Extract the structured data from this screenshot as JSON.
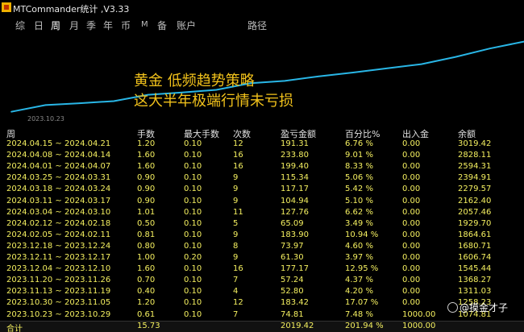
{
  "window": {
    "title": "MTCommander统计 ,V3.33",
    "icon": "app-icon"
  },
  "tabs": [
    {
      "label": "综",
      "active": false
    },
    {
      "label": "日",
      "active": false
    },
    {
      "label": "周",
      "active": true
    },
    {
      "label": "月",
      "active": false
    },
    {
      "label": "季",
      "active": false
    },
    {
      "label": "年",
      "active": false
    },
    {
      "label": "币",
      "active": false
    },
    {
      "label": "M",
      "active": false
    },
    {
      "label": "备",
      "active": false
    },
    {
      "label": "账户",
      "active": false
    },
    {
      "label": "路径",
      "active": false
    }
  ],
  "chart": {
    "line_color": "#29b6e6",
    "overlay_line1": "黄金  低频趋势策略",
    "overlay_line2": "这大半年极端行情未亏损",
    "date_label": "2023.10.23"
  },
  "chart_data": {
    "type": "line",
    "x": [
      "2023.10.23",
      "2023.10.30",
      "2023.11.13",
      "2023.11.20",
      "2023.12.04",
      "2023.12.11",
      "2023.12.18",
      "2024.02.05",
      "2024.02.12",
      "2024.03.04",
      "2024.03.11",
      "2024.03.18",
      "2024.03.25",
      "2024.04.01",
      "2024.04.08",
      "2024.04.15"
    ],
    "series": [
      {
        "values": [
          1074.81,
          1258.23,
          1311.03,
          1368.27,
          1545.44,
          1606.74,
          1680.71,
          1864.61,
          1929.7,
          2057.46,
          2162.4,
          2279.57,
          2394.91,
          2594.31,
          2828.11,
          3019.42
        ]
      }
    ],
    "title": "",
    "xlabel": "",
    "ylabel": "",
    "ylim": [
      1000,
      3100
    ],
    "grid": false
  },
  "table": {
    "headers": [
      "周",
      "手数",
      "最大手数",
      "次数",
      "盈亏金额",
      "百分比%",
      "出入金",
      "余额"
    ],
    "rows": [
      [
        "2024.04.15 ~ 2024.04.21",
        "1.20",
        "0.10",
        "12",
        "191.31",
        "6.76 %",
        "0.00",
        "3019.42"
      ],
      [
        "2024.04.08 ~ 2024.04.14",
        "1.60",
        "0.10",
        "16",
        "233.80",
        "9.01 %",
        "0.00",
        "2828.11"
      ],
      [
        "2024.04.01 ~ 2024.04.07",
        "1.60",
        "0.10",
        "16",
        "199.40",
        "8.33 %",
        "0.00",
        "2594.31"
      ],
      [
        "2024.03.25 ~ 2024.03.31",
        "0.90",
        "0.10",
        "9",
        "115.34",
        "5.06 %",
        "0.00",
        "2394.91"
      ],
      [
        "2024.03.18 ~ 2024.03.24",
        "0.90",
        "0.10",
        "9",
        "117.17",
        "5.42 %",
        "0.00",
        "2279.57"
      ],
      [
        "2024.03.11 ~ 2024.03.17",
        "0.90",
        "0.10",
        "9",
        "104.94",
        "5.10 %",
        "0.00",
        "2162.40"
      ],
      [
        "2024.03.04 ~ 2024.03.10",
        "1.01",
        "0.10",
        "11",
        "127.76",
        "6.62 %",
        "0.00",
        "2057.46"
      ],
      [
        "2024.02.12 ~ 2024.02.18",
        "0.50",
        "0.10",
        "5",
        "65.09",
        "3.49 %",
        "0.00",
        "1929.70"
      ],
      [
        "2024.02.05 ~ 2024.02.11",
        "0.81",
        "0.10",
        "9",
        "183.90",
        "10.94 %",
        "0.00",
        "1864.61"
      ],
      [
        "2023.12.18 ~ 2023.12.24",
        "0.80",
        "0.10",
        "8",
        "73.97",
        "4.60 %",
        "0.00",
        "1680.71"
      ],
      [
        "2023.12.11 ~ 2023.12.17",
        "1.00",
        "0.20",
        "9",
        "61.30",
        "3.97 %",
        "0.00",
        "1606.74"
      ],
      [
        "2023.12.04 ~ 2023.12.10",
        "1.60",
        "0.10",
        "16",
        "177.17",
        "12.95 %",
        "0.00",
        "1545.44"
      ],
      [
        "2023.11.20 ~ 2023.11.26",
        "0.70",
        "0.10",
        "7",
        "57.24",
        "4.37 %",
        "0.00",
        "1368.27"
      ],
      [
        "2023.11.13 ~ 2023.11.19",
        "0.40",
        "0.10",
        "4",
        "52.80",
        "4.20 %",
        "0.00",
        "1311.03"
      ],
      [
        "2023.10.30 ~ 2023.11.05",
        "1.20",
        "0.10",
        "12",
        "183.42",
        "17.07 %",
        "0.00",
        "1258.23"
      ],
      [
        "2023.10.23 ~ 2023.10.29",
        "0.61",
        "0.10",
        "7",
        "74.81",
        "7.48 %",
        "1000.00",
        "1074.81"
      ]
    ],
    "totals": [
      "合计",
      "15.73",
      "",
      "",
      "2019.42",
      "201.94 %",
      "1000.00",
      ""
    ]
  },
  "watermark": {
    "text": "@摸金才子"
  }
}
